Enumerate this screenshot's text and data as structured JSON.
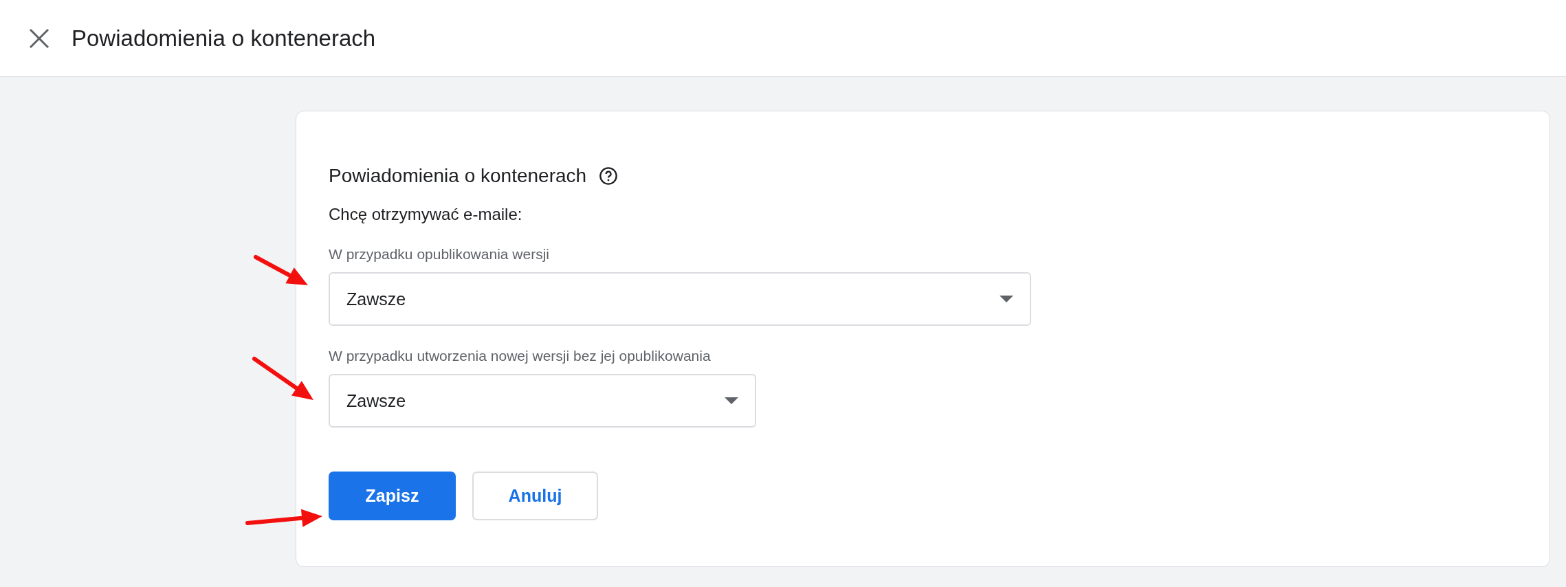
{
  "header": {
    "title": "Powiadomienia o kontenerach"
  },
  "card": {
    "title": "Powiadomienia o kontenerach",
    "subtitle": "Chcę otrzymywać e-maile:",
    "fields": [
      {
        "label": "W przypadku opublikowania wersji",
        "value": "Zawsze",
        "kind": "wide"
      },
      {
        "label": "W przypadku utworzenia nowej wersji bez jej opublikowania",
        "value": "Zawsze",
        "kind": "narrow"
      }
    ],
    "buttons": [
      {
        "label": "Zapisz",
        "kind": "primary"
      },
      {
        "label": "Anuluj",
        "kind": "secondary"
      }
    ]
  }
}
